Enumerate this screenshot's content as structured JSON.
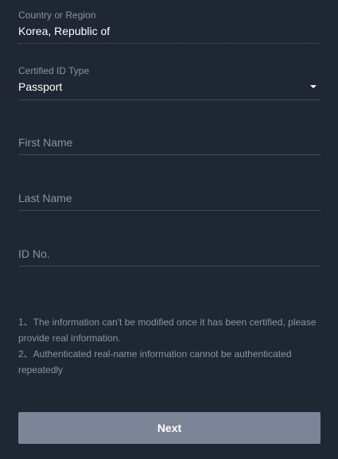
{
  "country": {
    "label": "Country or Region",
    "value": "Korea, Republic of"
  },
  "id_type": {
    "label": "Certified ID Type",
    "value": "Passport",
    "icon": "caret-down-icon"
  },
  "first_name": {
    "placeholder": "First Name"
  },
  "last_name": {
    "placeholder": "Last Name"
  },
  "id_no": {
    "placeholder": "ID No."
  },
  "notes": [
    "1、The information can't be modified once it has been certified, please provide real information.",
    "2、Authenticated real-name information cannot be authenticated repeatedly"
  ],
  "next_button": {
    "label": "Next"
  },
  "colors": {
    "background": "#1f2634",
    "label": "#8a93a6",
    "divider": "#3d4a60",
    "button": "#7b8597",
    "text": "#ffffff"
  }
}
